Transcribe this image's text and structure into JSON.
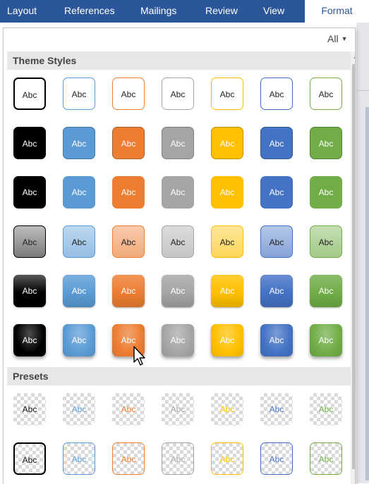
{
  "ribbon": {
    "tabs": [
      "Layout",
      "References",
      "Mailings",
      "Review",
      "View",
      "Format"
    ],
    "active_tab": "Format",
    "color": "#2b579a"
  },
  "gallery": {
    "filter_label": "All",
    "filter_icon": "dropdown-caret-icon",
    "theme_styles_header": "Theme Styles",
    "presets_header": "Presets",
    "tile_text": "Abc",
    "theme_colors": [
      "#000000",
      "#5b9bd5",
      "#ed7d31",
      "#a5a5a5",
      "#ffc000",
      "#4472c4",
      "#70ad47"
    ],
    "theme_style_rows": [
      "outline",
      "filled",
      "filled-no-border",
      "light-gradient",
      "gradient",
      "bevel"
    ],
    "preset_rows": [
      "transparent",
      "transparent-outline"
    ],
    "hovered_tile": {
      "row": 6,
      "column": 3
    }
  },
  "icons": {
    "pointer": "mouse-pointer-icon",
    "scroll_up": "scroll-up-arrow-icon"
  }
}
